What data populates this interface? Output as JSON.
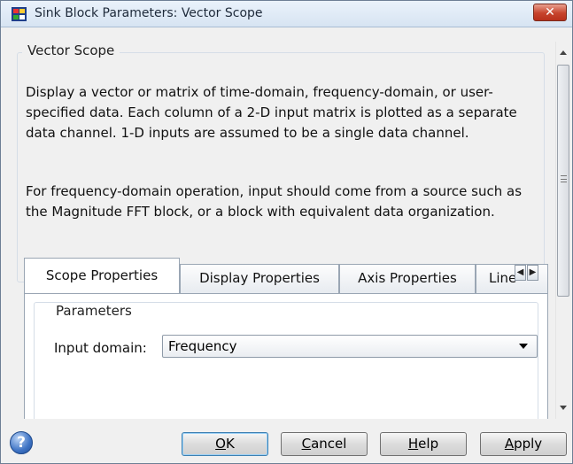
{
  "window": {
    "title": "Sink Block Parameters: Vector Scope",
    "close_glyph": "✕",
    "icon": "simulink-block-icon"
  },
  "description": {
    "group_title": "Vector Scope",
    "paragraph1": "Display a vector or matrix of time-domain, frequency-domain, or user-specified data.  Each column of a 2-D input matrix is plotted as a separate data channel.  1-D inputs are assumed to be a single data channel.",
    "paragraph2": "For frequency-domain operation, input should come from a source such as the Magnitude FFT block, or a block with equivalent data organization."
  },
  "tabs": [
    {
      "label": "Scope Properties",
      "active": true
    },
    {
      "label": "Display Properties",
      "active": false
    },
    {
      "label": "Axis Properties",
      "active": false
    },
    {
      "label": "Line",
      "active": false
    }
  ],
  "parameters": {
    "group_title": "Parameters",
    "input_domain": {
      "label": "Input domain:",
      "value": "Frequency"
    }
  },
  "buttons": {
    "ok": {
      "first": "O",
      "rest": "K"
    },
    "cancel": {
      "first": "C",
      "rest": "ancel"
    },
    "help": {
      "first": "H",
      "rest": "elp"
    },
    "apply": {
      "first": "A",
      "rest": "pply"
    }
  },
  "help_icon_glyph": "?",
  "colors": {
    "close_button": "#c7432c",
    "ok_focus_border": "#3c7fb1",
    "titlebar": "#d7e4f2"
  }
}
